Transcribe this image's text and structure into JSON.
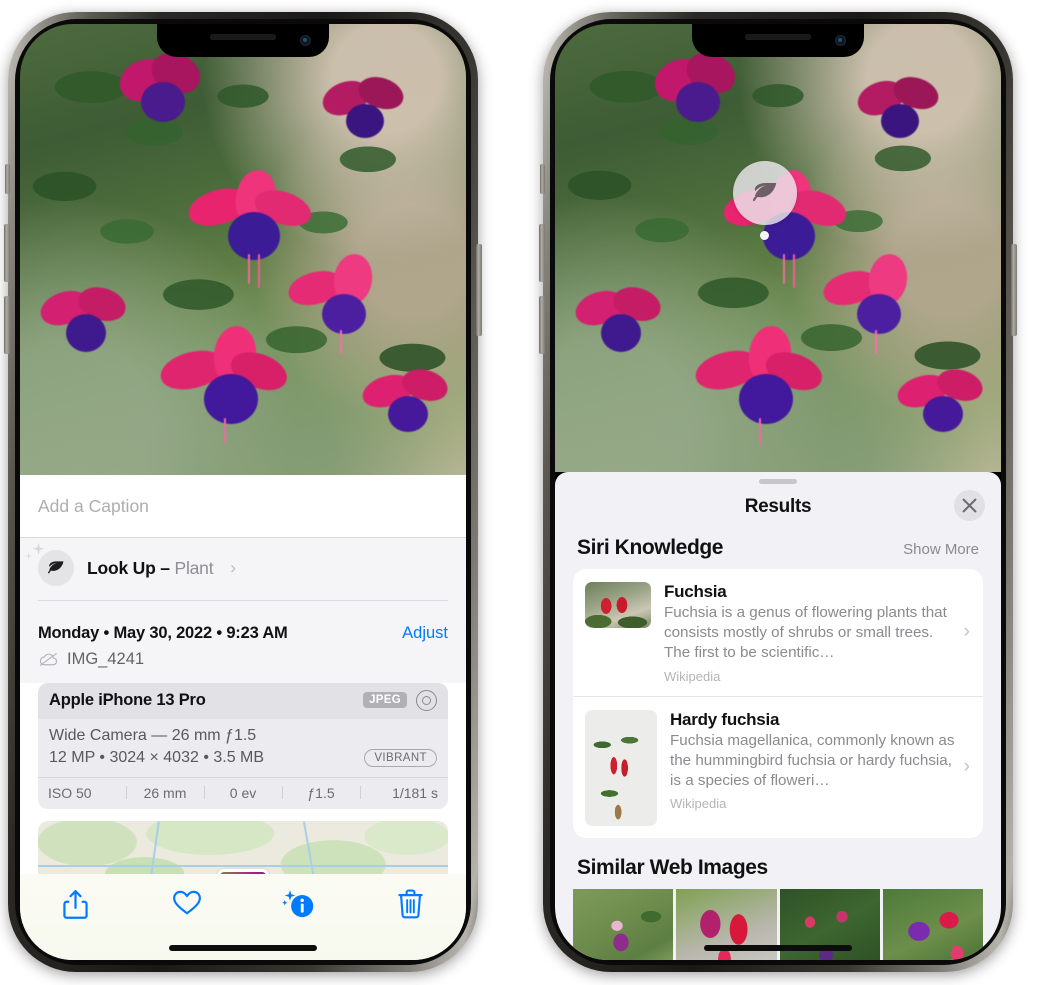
{
  "left_phone": {
    "name": "photos-info-view",
    "caption": {
      "placeholder": "Add a Caption",
      "value": ""
    },
    "lookup": {
      "icon": "leaf-icon",
      "label": "Look Up –",
      "subject": "Plant",
      "chevron": "›"
    },
    "date": {
      "text": "Monday • May 30, 2022 • 9:23 AM",
      "adjust_label": "Adjust"
    },
    "file": {
      "icon": "icloud-slash-icon",
      "name": "IMG_4241"
    },
    "exif": {
      "device": "Apple iPhone 13 Pro",
      "format_badge": "JPEG",
      "raptor_icon": "lens-icon",
      "lens_line": "Wide Camera — 26 mm ƒ1.5",
      "spec_line": "12 MP • 3024 × 4032 • 3.5 MB",
      "style_badge": "VIBRANT",
      "stats": [
        "ISO 50",
        "26 mm",
        "0 ev",
        "ƒ1.5",
        "1/181 s"
      ]
    },
    "toolbar": [
      {
        "name": "share-icon",
        "label": "Share"
      },
      {
        "name": "heart-icon",
        "label": "Favorite"
      },
      {
        "name": "info-sparkle-icon",
        "label": "Info"
      },
      {
        "name": "trash-icon",
        "label": "Delete"
      }
    ]
  },
  "right_phone": {
    "name": "visual-look-up-results",
    "badge": {
      "icon": "leaf-icon",
      "label": "Visual Look Up"
    },
    "sheet_title": "Results",
    "close_label": "✕",
    "siri_section": {
      "title": "Siri Knowledge",
      "action": "Show More"
    },
    "knowledge_cards": [
      {
        "title": "Fuchsia",
        "description": "Fuchsia is a genus of flowering plants that consists mostly of shrubs or small trees. The first to be scientific…",
        "source": "Wikipedia",
        "chevron": "›"
      },
      {
        "title": "Hardy fuchsia",
        "description": "Fuchsia magellanica, commonly known as the hummingbird fuchsia or hardy fuchsia, is a species of floweri…",
        "source": "Wikipedia",
        "chevron": "›"
      }
    ],
    "similar_section": {
      "title": "Similar Web Images"
    },
    "similar_images": [
      "web-image-1",
      "web-image-2",
      "web-image-3",
      "web-image-4"
    ]
  },
  "colors": {
    "accent_blue": "#007AFF",
    "sheet_bg": "#F2F1F6",
    "card_bg": "#FFFFFF",
    "muted_text": "#8A8A8F"
  }
}
